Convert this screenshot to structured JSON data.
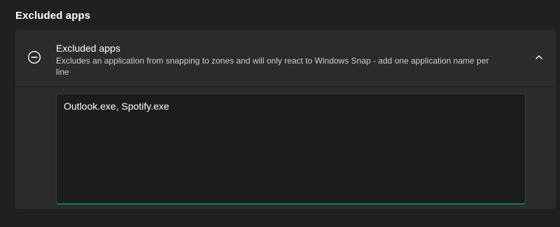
{
  "section": {
    "title": "Excluded apps"
  },
  "card": {
    "title": "Excluded apps",
    "description": "Excludes an application from snapping to zones and will only react to Windows Snap - add one application name per line",
    "icon": "minus-circle-icon",
    "expander_icon": "chevron-up-icon"
  },
  "textbox": {
    "value": "Outlook.exe, Spotify.exe"
  },
  "colors": {
    "background": "#202020",
    "card": "#2b2b2b",
    "textbox_bg": "#1c1c1c",
    "accent": "#0f7b63"
  }
}
